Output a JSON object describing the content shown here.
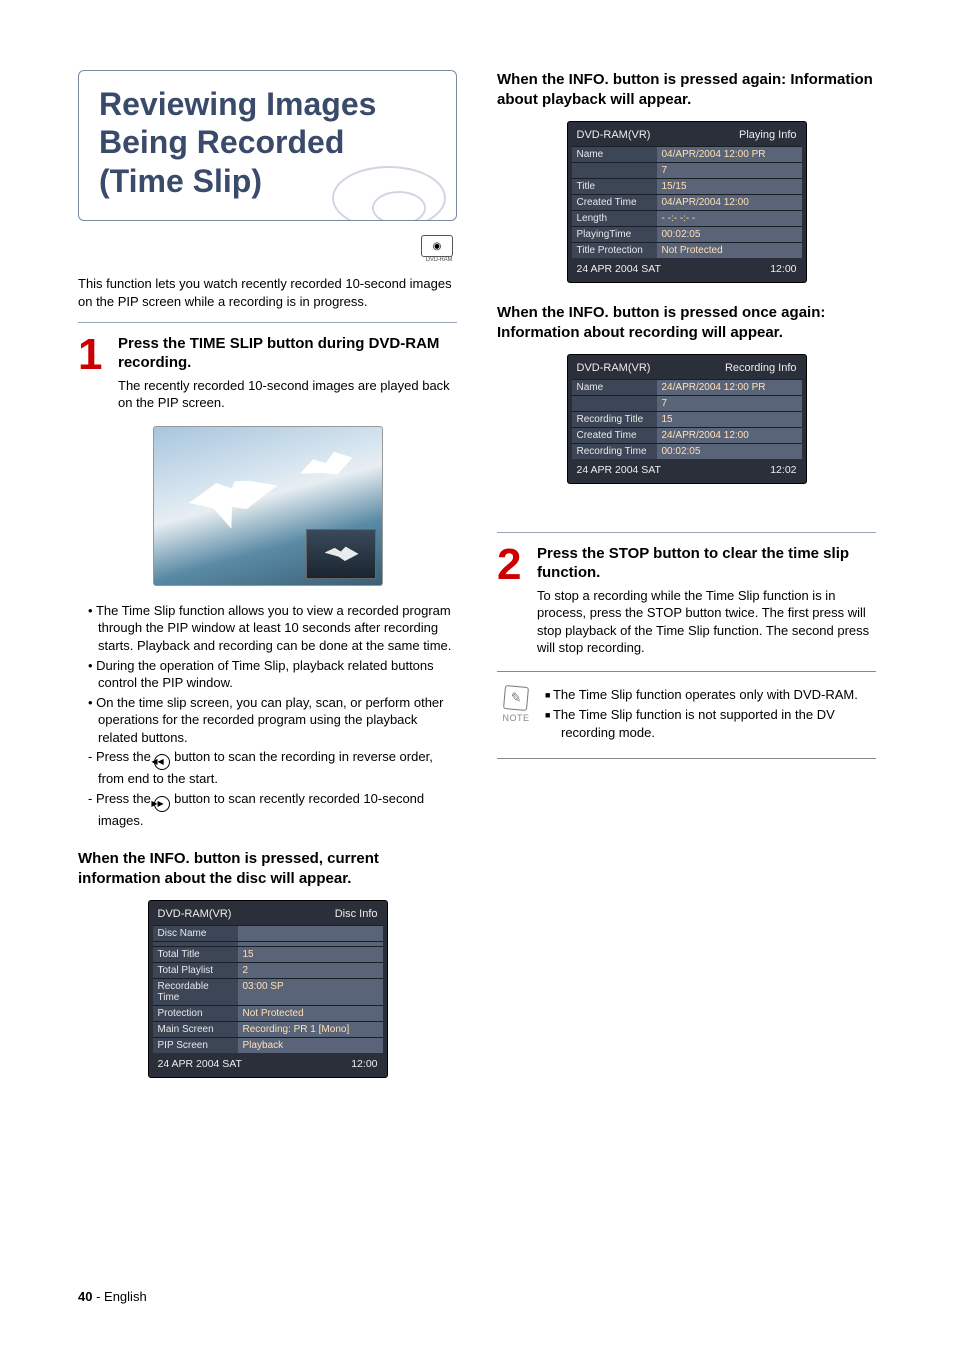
{
  "title": "Reviewing Images Being Recorded (Time Slip)",
  "badge_label": "DVD-RAM",
  "intro": "This function lets you watch recently recorded 10-second images on the PIP screen while a recording is in progress.",
  "step1": {
    "num": "1",
    "title": "Press the TIME SLIP button during DVD-RAM recording.",
    "desc": "The recently recorded 10-second images are played back on the PIP screen."
  },
  "bullets": {
    "b1": "The Time Slip function allows you to view a recorded program through the PIP window at least 10 seconds after recording starts. Playback and recording can be done at the same time.",
    "b2": "During the operation of Time Slip, playback related buttons control the PIP window.",
    "b3": "On the time slip screen, you can play, scan, or perform other operations for the recorded program using the playback related buttons.",
    "s1a": "Press the ",
    "s1b": " button to scan the recording in reverse order, from end to the start.",
    "s2a": "Press the ",
    "s2b": " button to scan recently recorded 10-second images."
  },
  "heading_disc": "When the INFO. button is pressed, current information about the disc will appear.",
  "panel_disc": {
    "head_left": "DVD-RAM(VR)",
    "head_right": "Disc Info",
    "rows": [
      {
        "label": "Disc Name",
        "value": ""
      },
      {
        "label": "",
        "value": ""
      },
      {
        "label": "Total Title",
        "value": "15"
      },
      {
        "label": "Total Playlist",
        "value": "2"
      },
      {
        "label": "Recordable Time",
        "value": "03:00 SP"
      },
      {
        "label": "Protection",
        "value": "Not Protected"
      },
      {
        "label": "Main Screen",
        "value": "Recording: PR 1 [Mono]"
      },
      {
        "label": "PIP Screen",
        "value": "Playback"
      }
    ],
    "foot_left": "24 APR 2004 SAT",
    "foot_right": "12:00"
  },
  "heading_play": "When the INFO. button is pressed again: Information about playback will appear.",
  "panel_play": {
    "head_left": "DVD-RAM(VR)",
    "head_right": "Playing Info",
    "rows": [
      {
        "label": "Name",
        "value": "04/APR/2004 12:00 PR"
      },
      {
        "label": "",
        "value": "7"
      },
      {
        "label": "Title",
        "value": "15/15"
      },
      {
        "label": "Created Time",
        "value": "04/APR/2004 12:00"
      },
      {
        "label": "Length",
        "value": "- -:- -:- -"
      },
      {
        "label": "PlayingTime",
        "value": "00:02:05"
      },
      {
        "label": "Title Protection",
        "value": "Not Protected"
      }
    ],
    "foot_left": "24 APR 2004 SAT",
    "foot_right": "12:00"
  },
  "heading_rec": "When the INFO. button is pressed once again: Information about recording will appear.",
  "panel_rec": {
    "head_left": "DVD-RAM(VR)",
    "head_right": "Recording Info",
    "rows": [
      {
        "label": "Name",
        "value": "24/APR/2004 12:00 PR"
      },
      {
        "label": "",
        "value": "7"
      },
      {
        "label": "Recording Title",
        "value": "15"
      },
      {
        "label": "Created Time",
        "value": "24/APR/2004 12:00"
      },
      {
        "label": "Recording Time",
        "value": "00:02:05"
      }
    ],
    "foot_left": "24 APR 2004 SAT",
    "foot_right": "12:02"
  },
  "step2": {
    "num": "2",
    "title": "Press the STOP button to clear the time slip function.",
    "desc": "To stop a recording while the Time Slip function is in process, press the STOP button twice. The first press will stop playback of the Time Slip function. The second press will stop recording."
  },
  "note": {
    "label": "NOTE",
    "n1": "The Time Slip function operates only with DVD-RAM.",
    "n2": "The Time Slip function is not supported in the DV recording mode."
  },
  "footer": {
    "page": "40",
    "sep": " - ",
    "lang": "English"
  }
}
